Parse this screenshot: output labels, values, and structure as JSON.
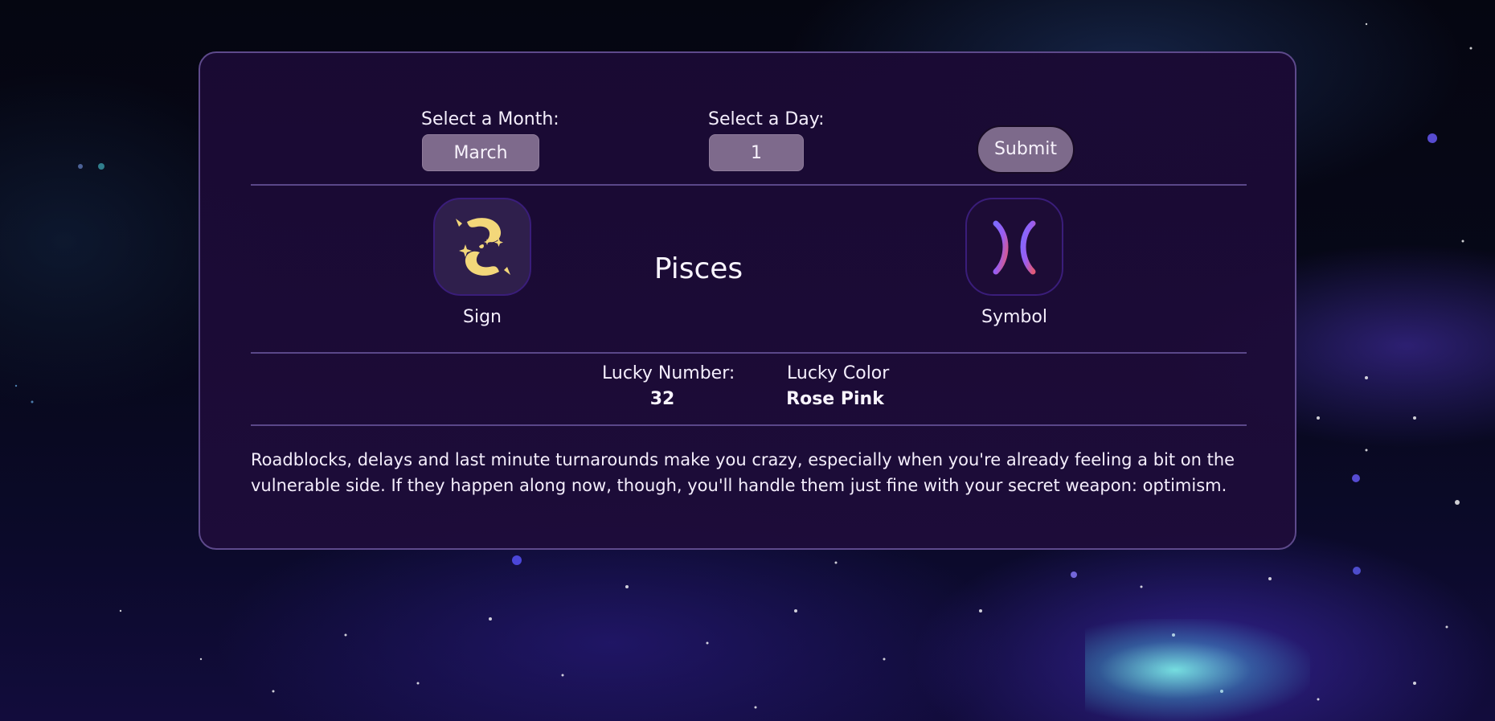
{
  "form": {
    "month_label": "Select a Month:",
    "month_value": "March",
    "day_label": "Select a Day:",
    "day_value": "1",
    "submit_label": "Submit"
  },
  "result": {
    "sign_name": "Pisces",
    "sign_caption": "Sign",
    "symbol_caption": "Symbol",
    "sign_icon": "pisces-fish-icon",
    "symbol_icon": "pisces-glyph-icon"
  },
  "lucky": {
    "number_label": "Lucky Number:",
    "number_value": "32",
    "color_label": "Lucky Color",
    "color_value": "Rose Pink"
  },
  "horoscope": {
    "text": "Roadblocks, delays and last minute turnarounds make you crazy, especially when you're already feeling a bit on the vulnerable side. If they happen along now, though, you'll handle them just fine with your secret weapon: optimism."
  },
  "colors": {
    "card_background": "#1c0a36",
    "card_border": "#5e4a8c",
    "input_background": "#7e6a8c",
    "divider": "#5a4789",
    "sign_icon_gold": "#f3d77a"
  }
}
